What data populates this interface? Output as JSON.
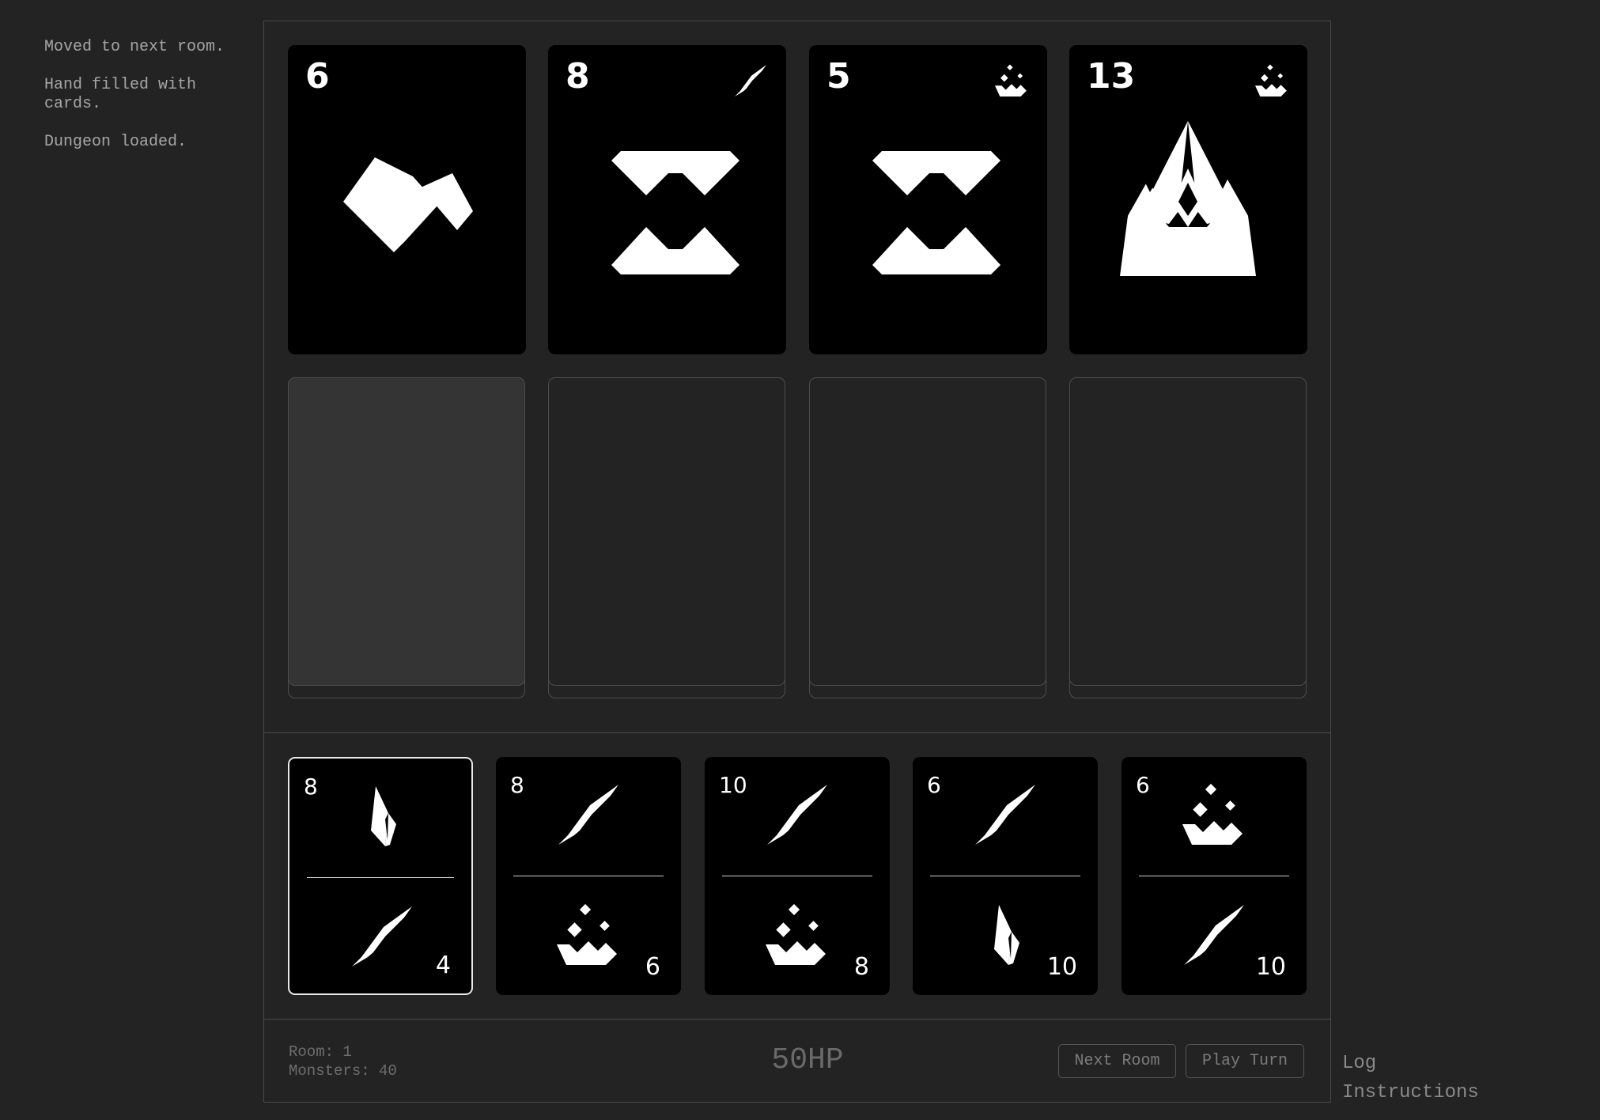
{
  "log": {
    "entries": [
      "Moved to next room.",
      "Hand filled with cards.",
      "Dungeon loaded."
    ]
  },
  "room": {
    "cards": [
      {
        "value": "6",
        "suit_icon": "",
        "art_icon": "broken-block-art"
      },
      {
        "value": "8",
        "suit_icon": "blade-icon",
        "art_icon": "hourglass-art"
      },
      {
        "value": "5",
        "suit_icon": "potion-icon",
        "art_icon": "hourglass-art"
      },
      {
        "value": "13",
        "suit_icon": "potion-icon",
        "art_icon": "pyramid-eye-art"
      }
    ],
    "slots": [
      {
        "state": "active"
      },
      {
        "state": "empty"
      },
      {
        "state": "empty"
      },
      {
        "state": "empty"
      }
    ]
  },
  "hand": {
    "cards": [
      {
        "top_value": "8",
        "top_icon": "crystal-icon",
        "bottom_value": "4",
        "bottom_icon": "blade-icon",
        "selected": true
      },
      {
        "top_value": "8",
        "top_icon": "blade-icon",
        "bottom_value": "6",
        "bottom_icon": "potion-icon",
        "selected": false
      },
      {
        "top_value": "10",
        "top_icon": "blade-icon",
        "bottom_value": "8",
        "bottom_icon": "potion-icon",
        "selected": false
      },
      {
        "top_value": "6",
        "top_icon": "blade-icon",
        "bottom_value": "10",
        "bottom_icon": "crystal-icon",
        "selected": false
      },
      {
        "top_value": "6",
        "top_icon": "potion-icon",
        "bottom_value": "10",
        "bottom_icon": "blade-icon",
        "selected": false
      }
    ]
  },
  "status": {
    "room_label": "Room: 1",
    "monsters_label": "Monsters: 40",
    "hp": "50HP"
  },
  "buttons": {
    "next_room": "Next Room",
    "play_turn": "Play Turn"
  },
  "side_links": {
    "log": "Log",
    "instructions": "Instructions"
  },
  "colors": {
    "background": "#232323",
    "card": "#000000",
    "border": "#4a4a4a",
    "slot_active": "#343434",
    "text": "#a6a6a6"
  }
}
